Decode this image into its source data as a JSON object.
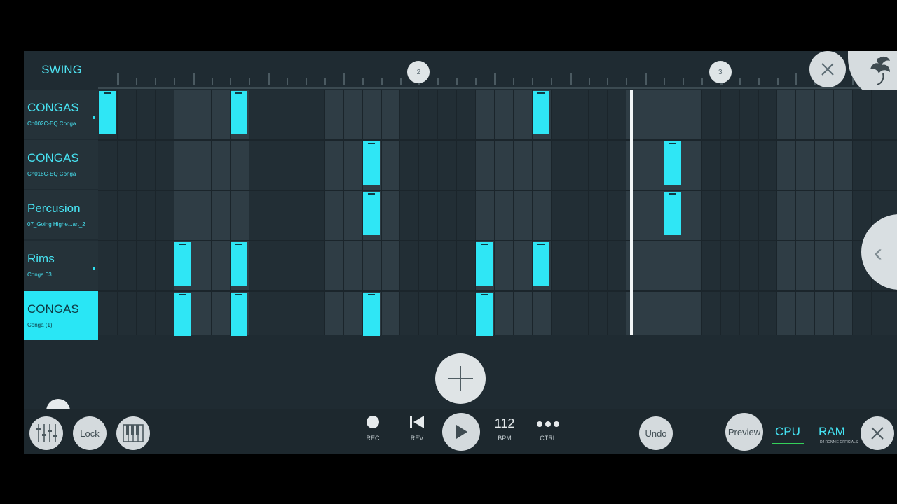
{
  "header": {
    "swing_label": "SWING",
    "bar_markers": [
      "2",
      "3"
    ]
  },
  "channels": [
    {
      "name": "CONGAS",
      "sample": "Cn002C-EQ Conga",
      "active": false,
      "muted_dot": true
    },
    {
      "name": "CONGAS",
      "sample": "Cn018C-EQ Conga",
      "active": false,
      "muted_dot": false
    },
    {
      "name": "Percusion",
      "sample": "07_Going Highe...art_2",
      "active": false,
      "muted_dot": false
    },
    {
      "name": "Rims",
      "sample": "Conga 03",
      "active": false,
      "muted_dot": true
    },
    {
      "name": "CONGAS",
      "sample": "Conga (1)",
      "active": true,
      "muted_dot": false
    }
  ],
  "pattern": {
    "steps_visible": 42,
    "playhead_step": 28.2,
    "rows": [
      [
        0,
        7,
        23
      ],
      [
        14,
        30
      ],
      [
        14,
        30
      ],
      [
        4,
        7,
        20,
        23
      ],
      [
        4,
        7,
        14,
        20
      ]
    ]
  },
  "toolbar": {
    "lock_label": "Lock",
    "rec_label": "REC",
    "rev_label": "REV",
    "tempo_value": "112",
    "tempo_unit": "BPM",
    "ctrl_label": "CTRL",
    "undo_label": "Undo",
    "preview_label": "Preview",
    "cpu_label": "CPU",
    "ram_label": "RAM",
    "watermark": "DJ RONNIE OFFICIALS"
  },
  "icons": {
    "close": "close-icon",
    "logo": "fruit-logo-icon",
    "add": "plus-icon",
    "collapse": "chevron-left-icon",
    "mixer": "mixer-sliders-icon",
    "piano": "piano-keys-icon",
    "record": "record-dot-icon",
    "rewind": "skip-back-icon",
    "play": "play-icon",
    "ctrl": "more-dots-icon"
  },
  "colors": {
    "accent": "#2fe6f5",
    "background": "#1f2b32",
    "cpu_meter": "#34d05a"
  }
}
